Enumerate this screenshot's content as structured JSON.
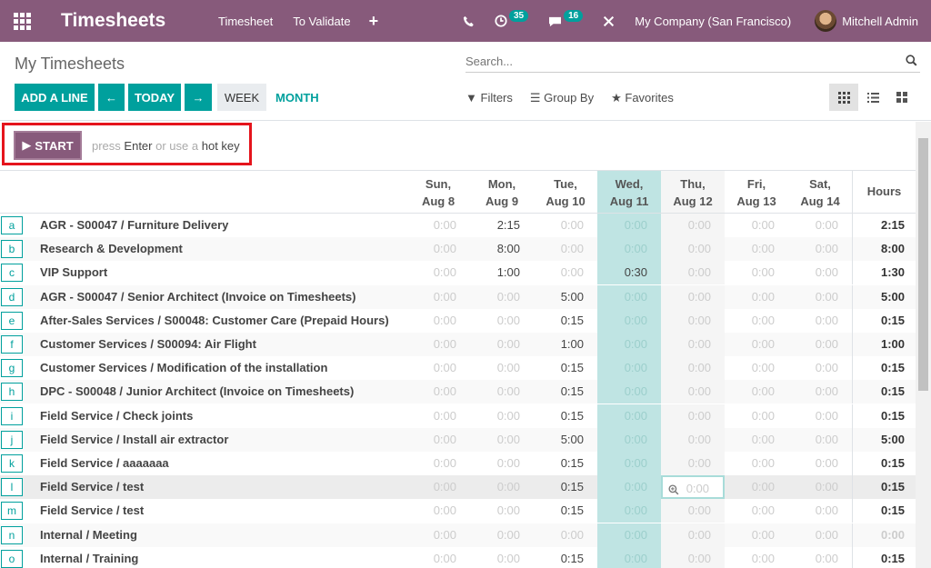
{
  "navbar": {
    "app_title": "Timesheets",
    "menu": [
      "Timesheet",
      "To Validate"
    ],
    "plus": "+",
    "activity_count": "35",
    "message_count": "16",
    "company": "My Company (San Francisco)",
    "user": "Mitchell Admin"
  },
  "breadcrumb": "My Timesheets",
  "search": {
    "placeholder": "Search..."
  },
  "buttons": {
    "add_line": "ADD A LINE",
    "prev": "←",
    "today": "TODAY",
    "next": "→",
    "week": "WEEK",
    "month": "MONTH"
  },
  "filters": {
    "filters": "Filters",
    "group_by": "Group By",
    "favorites": "Favorites"
  },
  "timer": {
    "start": "START",
    "hint_press": "press",
    "hint_enter": "Enter",
    "hint_or": "or use a",
    "hint_hotkey": "hot key"
  },
  "columns": [
    {
      "day": "Sun,",
      "date": "Aug 8"
    },
    {
      "day": "Mon,",
      "date": "Aug 9"
    },
    {
      "day": "Tue,",
      "date": "Aug 10"
    },
    {
      "day": "Wed,",
      "date": "Aug 11"
    },
    {
      "day": "Thu,",
      "date": "Aug 12"
    },
    {
      "day": "Fri,",
      "date": "Aug 13"
    },
    {
      "day": "Sat,",
      "date": "Aug 14"
    }
  ],
  "hours_header": "Hours",
  "rows": [
    {
      "key": "a",
      "label": "AGR - S00047 / Furniture Delivery",
      "values": [
        "0:00",
        "2:15",
        "0:00",
        "0:00",
        "0:00",
        "0:00",
        "0:00"
      ],
      "total": "2:15"
    },
    {
      "key": "b",
      "label": "Research & Development",
      "values": [
        "0:00",
        "8:00",
        "0:00",
        "0:00",
        "0:00",
        "0:00",
        "0:00"
      ],
      "total": "8:00"
    },
    {
      "key": "c",
      "label": "VIP Support",
      "values": [
        "0:00",
        "1:00",
        "0:00",
        "0:30",
        "0:00",
        "0:00",
        "0:00"
      ],
      "total": "1:30"
    },
    {
      "key": "d",
      "label": "AGR - S00047 / Senior Architect (Invoice on Timesheets)",
      "values": [
        "0:00",
        "0:00",
        "5:00",
        "0:00",
        "0:00",
        "0:00",
        "0:00"
      ],
      "total": "5:00"
    },
    {
      "key": "e",
      "label": "After-Sales Services / S00048: Customer Care (Prepaid Hours)",
      "values": [
        "0:00",
        "0:00",
        "0:15",
        "0:00",
        "0:00",
        "0:00",
        "0:00"
      ],
      "total": "0:15"
    },
    {
      "key": "f",
      "label": "Customer Services / S00094: Air Flight",
      "values": [
        "0:00",
        "0:00",
        "1:00",
        "0:00",
        "0:00",
        "0:00",
        "0:00"
      ],
      "total": "1:00"
    },
    {
      "key": "g",
      "label": "Customer Services / Modification of the installation",
      "values": [
        "0:00",
        "0:00",
        "0:15",
        "0:00",
        "0:00",
        "0:00",
        "0:00"
      ],
      "total": "0:15"
    },
    {
      "key": "h",
      "label": "DPC - S00048 / Junior Architect (Invoice on Timesheets)",
      "values": [
        "0:00",
        "0:00",
        "0:15",
        "0:00",
        "0:00",
        "0:00",
        "0:00"
      ],
      "total": "0:15"
    },
    {
      "key": "i",
      "label": "Field Service / Check joints",
      "values": [
        "0:00",
        "0:00",
        "0:15",
        "0:00",
        "0:00",
        "0:00",
        "0:00"
      ],
      "total": "0:15"
    },
    {
      "key": "j",
      "label": "Field Service / Install air extractor",
      "values": [
        "0:00",
        "0:00",
        "5:00",
        "0:00",
        "0:00",
        "0:00",
        "0:00"
      ],
      "total": "5:00"
    },
    {
      "key": "k",
      "label": "Field Service / aaaaaaa",
      "values": [
        "0:00",
        "0:00",
        "0:15",
        "0:00",
        "0:00",
        "0:00",
        "0:00"
      ],
      "total": "0:15"
    },
    {
      "key": "l",
      "label": "Field Service / test",
      "values": [
        "0:00",
        "0:00",
        "0:15",
        "0:00",
        "0:00",
        "0:00",
        "0:00"
      ],
      "total": "0:15"
    },
    {
      "key": "m",
      "label": "Field Service / test",
      "values": [
        "0:00",
        "0:00",
        "0:15",
        "0:00",
        "0:00",
        "0:00",
        "0:00"
      ],
      "total": "0:15"
    },
    {
      "key": "n",
      "label": "Internal / Meeting",
      "values": [
        "0:00",
        "0:00",
        "0:00",
        "0:00",
        "0:00",
        "0:00",
        "0:00"
      ],
      "total": "0:00"
    },
    {
      "key": "o",
      "label": "Internal / Training",
      "values": [
        "0:00",
        "0:00",
        "0:15",
        "0:00",
        "0:00",
        "0:00",
        "0:00"
      ],
      "total": "0:15"
    }
  ],
  "colors": {
    "brand": "#875a7b",
    "accent": "#00a09d",
    "today_col": "#bfe4e3",
    "highlight_box": "#e5141c"
  }
}
